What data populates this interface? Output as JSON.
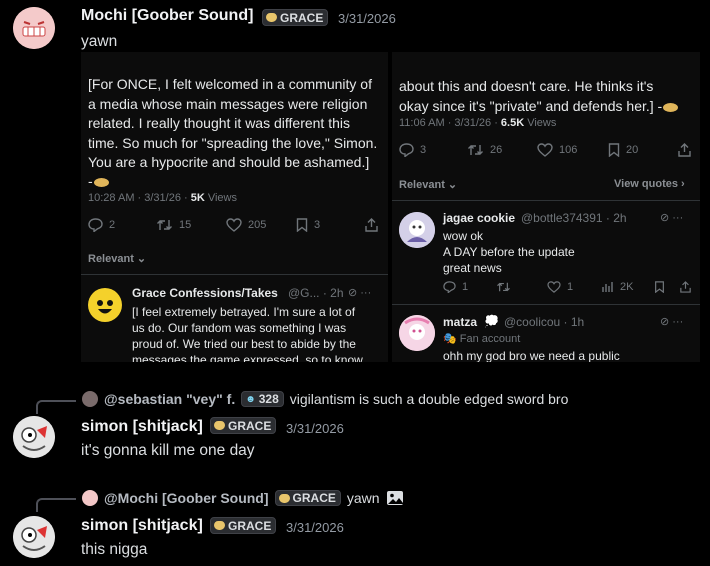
{
  "message1": {
    "author": "Mochi [Goober Sound]",
    "tag": "GRACE",
    "timestamp": "3/31/2026",
    "text": "yawn"
  },
  "screenshot_left": {
    "tweet_text": "[For ONCE, I felt welcomed in a community of\na media whose main messages were religion\nrelated. I really thought it was different this\ntime. So much for \"spreading the love,\" Simon.\nYou are a hypocrite and should be ashamed.]\n-",
    "time": "10:28 AM · 3/31/26 · ",
    "views_count": "5K",
    "views_label": " Views",
    "replies": "2",
    "retweets": "15",
    "likes": "205",
    "bookmarks": "3",
    "relevant": "Relevant",
    "reply_name": "Grace Confessions/Takes",
    "reply_handle": "@G... · 2h",
    "reply_text": "[I feel extremely betrayed. I'm sure a lot of\nus do. Our fandom was something I was\nproud of. We tried our best to abide by the\nmessages the game expressed, so to know"
  },
  "screenshot_right": {
    "tweet_text": "about this and doesn't care. He thinks it's\nokay since it's \"private\" and defends her.] -",
    "time": "11:06 AM · 3/31/26 · ",
    "views_count": "6.5K",
    "views_label": " Views",
    "replies": "3",
    "retweets": "26",
    "likes": "106",
    "bookmarks": "20",
    "relevant": "Relevant",
    "view_quotes": "View quotes",
    "reply1": {
      "name": "jagae cookie",
      "handle": "@bottle374391 · 2h",
      "text": "wow ok\nA DAY before the update\ngreat news",
      "replies": "1",
      "likes": "1",
      "views": "2K"
    },
    "reply2": {
      "name": "matza",
      "handle": "@coolicou · 1h",
      "badge": "Fan account",
      "text": "ohh my god bro we need a public"
    }
  },
  "message2": {
    "ref_author": "@sebastian \"vey\" f.",
    "ref_tag": "328",
    "ref_text": "vigilantism is such a double edged sword bro",
    "author": "simon [shitjack]",
    "tag": "GRACE",
    "timestamp": "3/31/2026",
    "text": "it's gonna kill me one day"
  },
  "message3": {
    "ref_author": "@Mochi [Goober Sound]",
    "ref_tag": "GRACE",
    "ref_text": "yawn",
    "author": "simon [shitjack]",
    "tag": "GRACE",
    "timestamp": "3/31/2026",
    "text": "this nigga"
  },
  "colors": {
    "background": "#000000",
    "tag_heart": "#e8c56b",
    "twitter_blue": "#1d9bf0"
  }
}
